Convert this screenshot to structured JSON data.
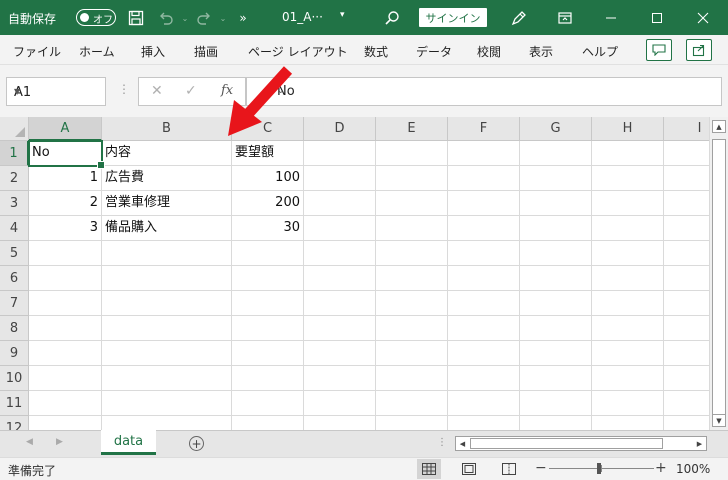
{
  "titlebar": {
    "autosave_label": "自動保存",
    "autosave_state": "オフ",
    "filename": "01_A···",
    "signin": "サインイン",
    "qa_icons": [
      "save-icon",
      "undo-icon",
      "redo-icon",
      "more-icon"
    ]
  },
  "menu": {
    "items": [
      "ファイル",
      "ホーム",
      "挿入",
      "描画",
      "ページ レイアウト",
      "数式",
      "データ",
      "校閲",
      "表示",
      "ヘルプ"
    ]
  },
  "formula_bar": {
    "name_box": "A1",
    "content": "No"
  },
  "grid": {
    "columns": [
      "A",
      "B",
      "C",
      "D",
      "E",
      "F",
      "G",
      "H",
      "I"
    ],
    "rows": [
      "1",
      "2",
      "3",
      "4",
      "5",
      "6",
      "7",
      "8",
      "9",
      "10",
      "11",
      "12"
    ],
    "cells": [
      [
        "No",
        "内容",
        "要望額"
      ],
      [
        "1",
        "広告費",
        "100"
      ],
      [
        "2",
        "営業車修理",
        "200"
      ],
      [
        "3",
        "備品購入",
        "30"
      ]
    ],
    "active_cell": "A1"
  },
  "sheet_tabs": {
    "tabs": [
      "data"
    ],
    "active": "data"
  },
  "status_bar": {
    "status": "準備完了",
    "zoom": "100%"
  },
  "colors": {
    "accent": "#217346",
    "annotation": "#e8151b"
  }
}
